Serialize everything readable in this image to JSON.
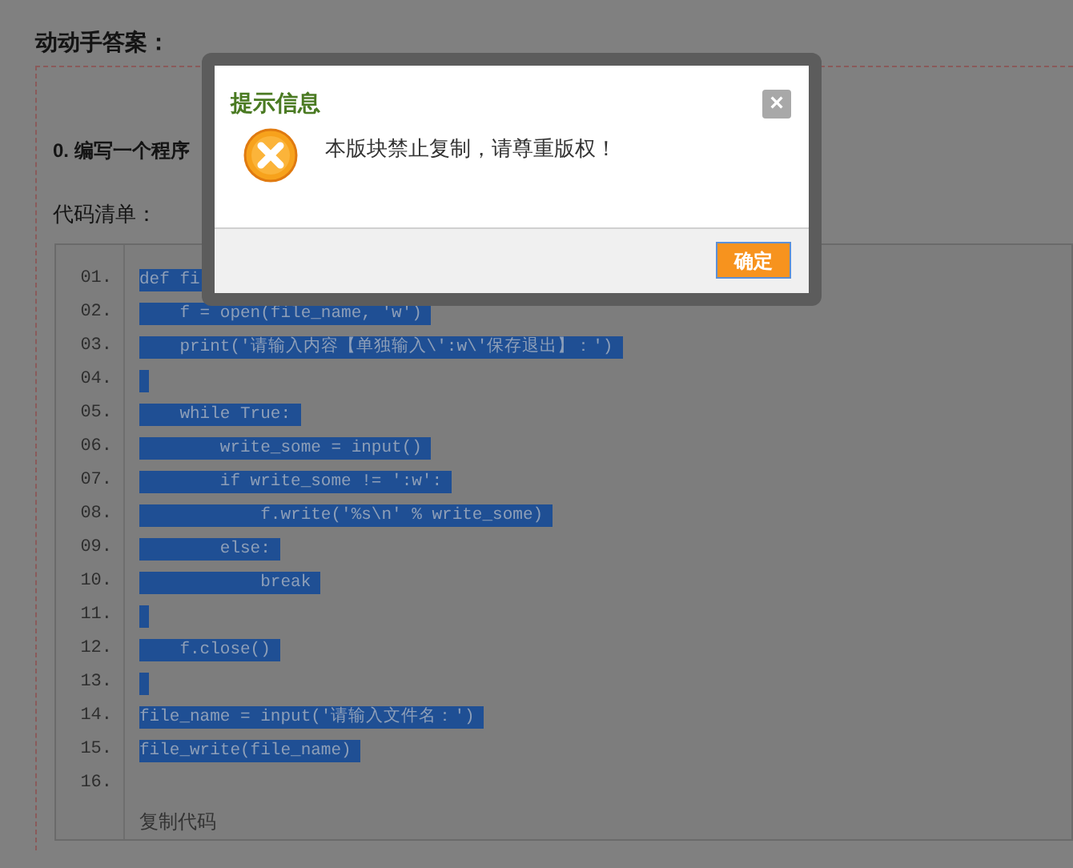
{
  "page": {
    "heading": "动动手答案：",
    "problem_title": "0. 编写一个程序",
    "code_label": "代码清单：",
    "code_lines": [
      {
        "number": "01.",
        "text": "def fi",
        "selected": true
      },
      {
        "number": "02.",
        "text": "    f = open(file_name, 'w')",
        "selected": true
      },
      {
        "number": "03.",
        "text": "    print('请输入内容【单独输入\\':w\\'保存退出】：')",
        "selected": true
      },
      {
        "number": "04.",
        "selected": true
      },
      {
        "number": "05.",
        "text": "    while True:",
        "selected": true
      },
      {
        "number": "06.",
        "text": "        write_some = input()",
        "selected": true
      },
      {
        "number": "07.",
        "text": "        if write_some != ':w':",
        "selected": true
      },
      {
        "number": "08.",
        "text": "            f.write('%s\\n' % write_some)",
        "selected": true
      },
      {
        "number": "09.",
        "text": "        else:",
        "selected": true
      },
      {
        "number": "10.",
        "text": "            break",
        "selected": true
      },
      {
        "number": "11.",
        "selected": true
      },
      {
        "number": "12.",
        "text": "    f.close()",
        "selected": true
      },
      {
        "number": "13.",
        "selected": true
      },
      {
        "number": "14.",
        "text": "file_name = input('请输入文件名：')",
        "selected": true
      },
      {
        "number": "15.",
        "text": "file_write(file_name)",
        "selected": true
      },
      {
        "number": "16."
      }
    ],
    "copy_link": "复制代码"
  },
  "dialog": {
    "title": "提示信息",
    "close": "×",
    "message": "本版块禁止复制，请尊重版权！",
    "ok_button": "确定"
  }
}
